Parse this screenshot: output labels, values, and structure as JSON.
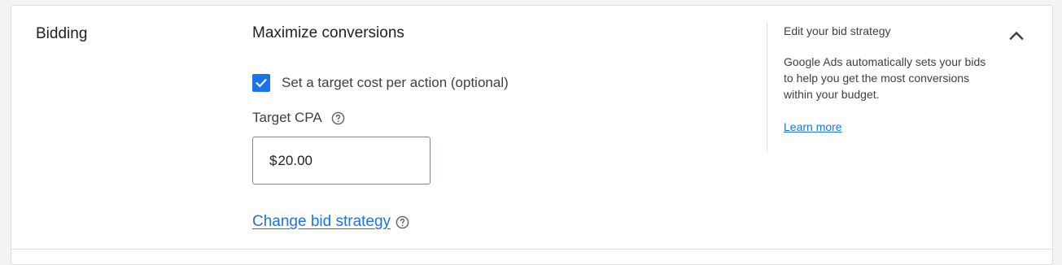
{
  "section": {
    "title": "Bidding"
  },
  "strategy": {
    "name": "Maximize conversions",
    "checkbox_label": "Set a target cost per action (optional)",
    "checkbox_checked": true,
    "target_label": "Target CPA",
    "target_currency": "$",
    "target_value": "20.00",
    "change_link": "Change bid strategy"
  },
  "side_panel": {
    "title": "Edit your bid strategy",
    "body": "Google Ads automatically sets your bids to help you get the most conversions within your budget.",
    "learn_more": "Learn more"
  },
  "icons": {
    "checkbox": "check-icon",
    "help": "help-circle-icon",
    "collapse": "chevron-up-icon"
  },
  "colors": {
    "accent": "#1a73e8",
    "text": "#202124",
    "border": "#dadce0"
  }
}
